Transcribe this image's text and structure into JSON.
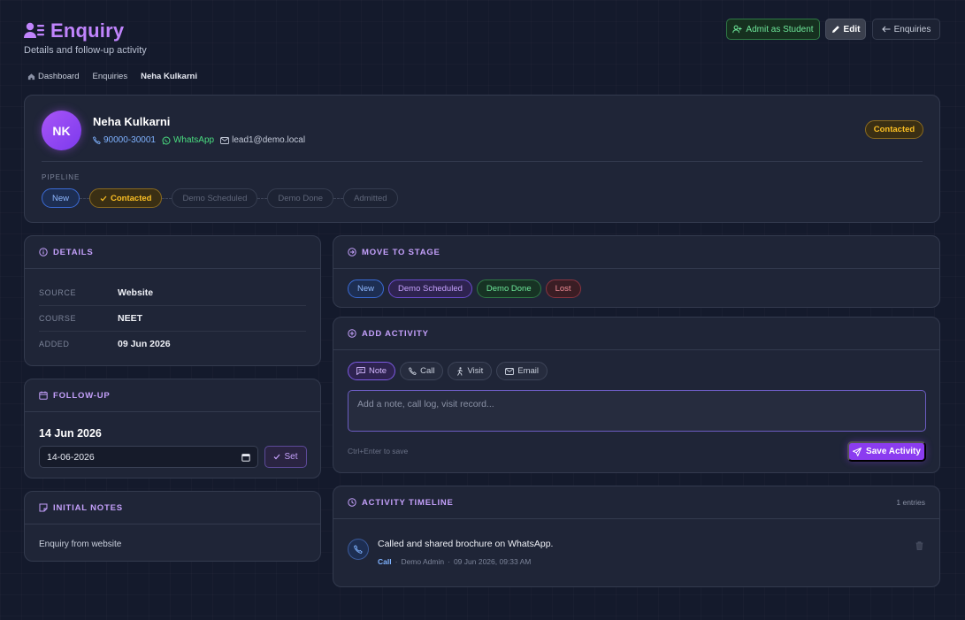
{
  "header": {
    "title": "Enquiry",
    "subtitle": "Details and follow-up activity",
    "admit_label": "Admit as Student",
    "edit_label": "Edit",
    "enquiries_label": "Enquiries"
  },
  "breadcrumb": [
    "Dashboard",
    "Enquiries",
    "Neha Kulkarni"
  ],
  "profile": {
    "initials": "NK",
    "name": "Neha Kulkarni",
    "phone": "90000-30001",
    "whatsapp": "WhatsApp",
    "email": "lead1@demo.local",
    "status": "Contacted"
  },
  "pipeline": {
    "label": "PIPELINE",
    "stages": [
      {
        "label": "New",
        "state": "done"
      },
      {
        "label": "Contacted",
        "state": "active"
      },
      {
        "label": "Demo Scheduled",
        "state": "pending"
      },
      {
        "label": "Demo Done",
        "state": "pending"
      },
      {
        "label": "Admitted",
        "state": "pending"
      }
    ]
  },
  "details": {
    "title": "DETAILS",
    "rows": [
      {
        "label": "SOURCE",
        "value": "Website"
      },
      {
        "label": "COURSE",
        "value": "NEET"
      },
      {
        "label": "ADDED",
        "value": "09 Jun 2026"
      }
    ]
  },
  "followup": {
    "title": "FOLLOW-UP",
    "date_display": "14 Jun 2026",
    "input_value": "14-06-2026",
    "set_label": "Set"
  },
  "notes": {
    "title": "INITIAL NOTES",
    "text": "Enquiry from website"
  },
  "move_stage": {
    "title": "MOVE TO STAGE",
    "options": [
      "New",
      "Demo Scheduled",
      "Demo Done",
      "Lost"
    ]
  },
  "activity": {
    "title": "ADD ACTIVITY",
    "tabs": [
      "Note",
      "Call",
      "Visit",
      "Email"
    ],
    "selected_tab": "Note",
    "placeholder": "Add a note, call log, visit record...",
    "hint": "Ctrl+Enter to save",
    "save_label": "Save Activity"
  },
  "timeline": {
    "title": "ACTIVITY TIMELINE",
    "count_label": "1 entries",
    "entries": [
      {
        "text": "Called and shared brochure on WhatsApp.",
        "type": "Call",
        "by": "Demo Admin",
        "time": "09 Jun 2026, 09:33 AM"
      }
    ]
  },
  "colors": {
    "accent": "#c084fc",
    "primary_button": "#8b3cf0",
    "status_contacted": "#fbbf24",
    "whatsapp": "#4ade80",
    "link_blue": "#7fb2ff"
  }
}
